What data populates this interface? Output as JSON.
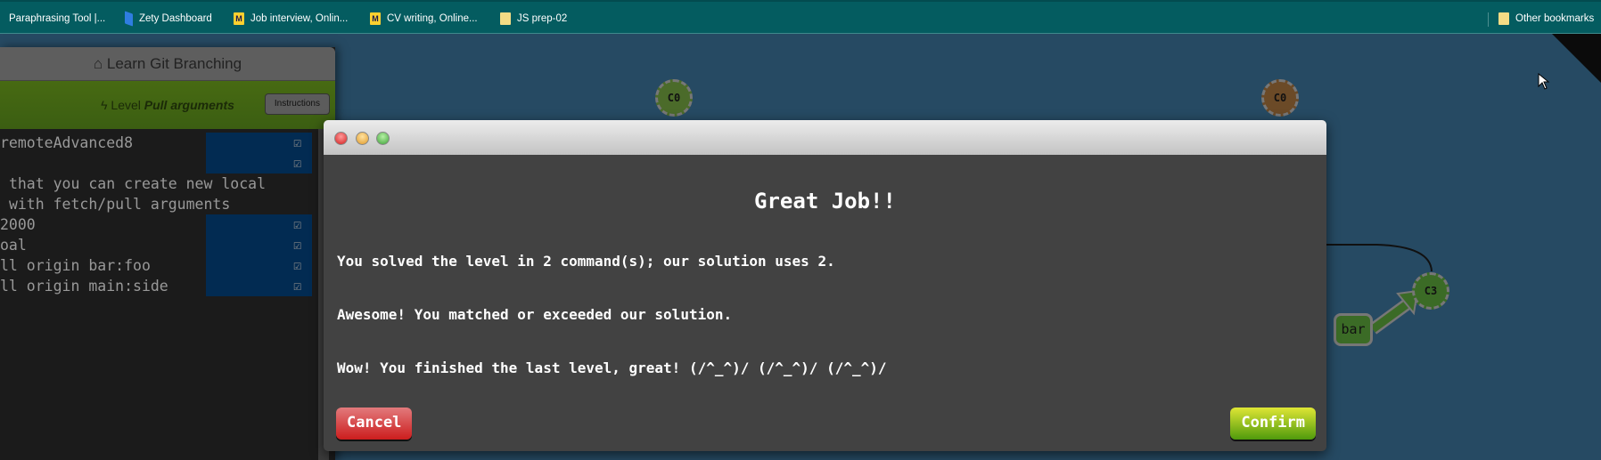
{
  "bookmarks": [
    "Paraphrasing Tool |...",
    "Zety Dashboard",
    "Job interview, Onlin...",
    "CV writing, Online...",
    "JS prep-02"
  ],
  "other_bookmarks": "Other bookmarks",
  "panel": {
    "title": "Learn Git Branching",
    "level_prefix": "Level",
    "level_name": "Pull arguments",
    "instructions": "Instructions",
    "terminal": [
      "remoteAdvanced8",
      "",
      "that you can create new local",
      "with fetch/pull arguments",
      "2000",
      "oal",
      "ll origin bar:foo",
      "ll origin main:side"
    ]
  },
  "graph": {
    "nodes": [
      "C0",
      "C0",
      "C3"
    ],
    "branch": "bar"
  },
  "modal": {
    "title": "Great Job!!",
    "line1": "You solved the level in 2 command(s); our solution uses 2.",
    "line2": "Awesome! You matched or exceeded our solution.",
    "line3": "Wow! You finished the last level, great! (/^_^)/ (/^_^)/ (/^_^)/",
    "cancel": "Cancel",
    "confirm": "Confirm"
  }
}
